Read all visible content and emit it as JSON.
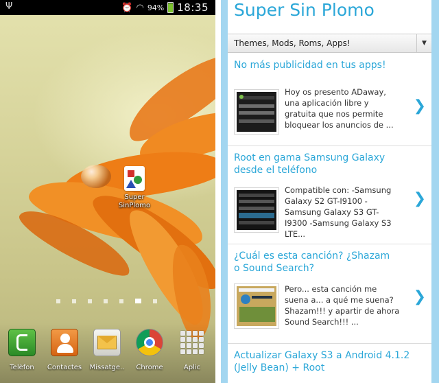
{
  "status_bar": {
    "battery_pct": "94%",
    "time": "18:35",
    "icons": [
      "usb-icon",
      "alarm-icon",
      "wifi-icon",
      "signal-icon",
      "battery-charging-icon"
    ]
  },
  "home": {
    "shortcut": {
      "label_line1": "Super",
      "label_line2": "SinPlomo",
      "icon": "super-sin-plomo-icon"
    },
    "pages": {
      "count": 7,
      "active": 6
    },
    "dock": [
      {
        "label": "Telèfon",
        "icon": "phone-icon"
      },
      {
        "label": "Contactes",
        "icon": "contacts-icon"
      },
      {
        "label": "Missatge..",
        "icon": "messaging-icon"
      },
      {
        "label": "Chrome",
        "icon": "chrome-icon"
      },
      {
        "label": "Aplic",
        "icon": "apps-icon"
      }
    ]
  },
  "web": {
    "site_title": "Super Sin Plomo",
    "menu_select": {
      "value": "Themes, Mods, Roms, Apps!",
      "arrow": "▼"
    },
    "posts": [
      {
        "title": "No más publicidad en tus apps!",
        "excerpt": "Hoy os presento ADaway, una aplicación libre y gratuita que nos permite bloquear los anuncios de ...",
        "chevron": "❯"
      },
      {
        "title": "Root en gama Samsung Galaxy desde el teléfono",
        "excerpt": "Compatible con: -Samsung Galaxy S2 GT-I9100 -Samsung Galaxy S3 GT-I9300 -Samsung Galaxy S3 LTE...",
        "chevron": "❯"
      },
      {
        "title": "¿Cuál es esta canción? ¿Shazam o Sound Search?",
        "excerpt": "Pero... esta canción me suena a... a qué me suena? Shazam!!! y apartir de ahora Sound Search!!! ...",
        "chevron": "❯"
      },
      {
        "title": "Actualizar Galaxy S3 a Android 4.1.2 (Jelly Bean) + Root",
        "excerpt": "",
        "chevron": ""
      }
    ]
  },
  "colors": {
    "accent": "#2ba7d8",
    "sidebar": "#a3d6f0",
    "status_bar": "#000000"
  }
}
